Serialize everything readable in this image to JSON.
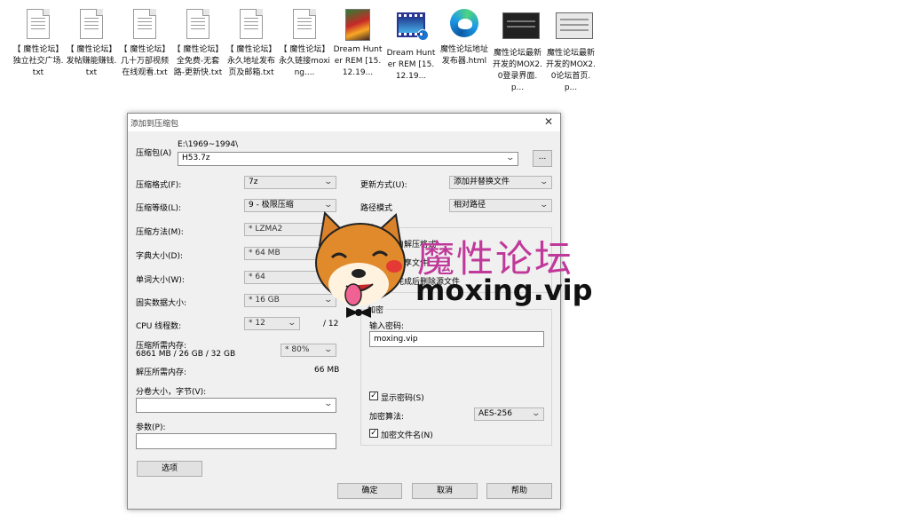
{
  "desktop": {
    "icons": [
      {
        "label": "【 魔性论坛】独立社交广场.txt",
        "type": "text-file-icon"
      },
      {
        "label": "【 魔性论坛】发帖赚能赚钱.txt",
        "type": "text-file-icon"
      },
      {
        "label": "【 魔性论坛】几十万部视频在线观看.txt",
        "type": "text-file-icon"
      },
      {
        "label": "【 魔性论坛】全免费-无套路-更新快.txt",
        "type": "text-file-icon"
      },
      {
        "label": "【 魔性论坛】永久地址发布页及邮箱.txt",
        "type": "text-file-icon"
      },
      {
        "label": "【 魔性论坛】永久链接moxing....",
        "type": "text-file-icon"
      },
      {
        "label": "Dream Hunter REM [15.12.19...",
        "type": "poster-image-icon"
      },
      {
        "label": "Dream Hunter REM [15.12.19...",
        "type": "video-file-icon"
      },
      {
        "label": "魔性论坛地址发布器.html",
        "type": "edge-browser-icon"
      },
      {
        "label": "魔性论坛最新开发的MOX2.0登录界面.p...",
        "type": "screenshot-image-icon"
      },
      {
        "label": "魔性论坛最新开发的MOX2.0论坛首页.p...",
        "type": "screenshot-image-icon"
      }
    ]
  },
  "dialog": {
    "title": "添加到压缩包",
    "close_glyph": "✕",
    "archive": {
      "label": "压缩包(A)",
      "path": "E:\\1969~1994\\",
      "filename": "H53.7z",
      "browse_label": "..."
    },
    "left": {
      "format": {
        "label": "压缩格式(F):",
        "value": "7z"
      },
      "level": {
        "label": "压缩等级(L):",
        "value": "9 - 极限压缩"
      },
      "method": {
        "label": "压缩方法(M):",
        "value": "* LZMA2"
      },
      "dict": {
        "label": "字典大小(D):",
        "value": "* 64 MB"
      },
      "word": {
        "label": "单词大小(W):",
        "value": "* 64"
      },
      "solid": {
        "label": "固实数据大小:",
        "value": "* 16 GB"
      },
      "threads": {
        "label": "CPU 线程数:",
        "value": "* 12",
        "max": "/ 12"
      },
      "mem_compress": {
        "label": "压缩所需内存:",
        "detail": "6861 MB / 26 GB / 32 GB",
        "value": "* 80%"
      },
      "mem_decompress": {
        "label": "解压所需内存:",
        "value": "66 MB"
      },
      "volume": {
        "label": "分卷大小，字节(V):",
        "value": ""
      },
      "params": {
        "label": "参数(P):",
        "value": ""
      },
      "options_button": "选项"
    },
    "right": {
      "update": {
        "label": "更新方式(U):",
        "value": "添加并替换文件"
      },
      "path_mode": {
        "label": "路径模式",
        "value": "相对路径"
      },
      "options_group": {
        "label": "选",
        "sfx": "创建自解压格式",
        "shared": "压缩共享文件",
        "delete": "压缩完成后删除源文件"
      },
      "encryption": {
        "label": "加密",
        "password_label": "输入密码:",
        "password_value": "moxing.vip",
        "show_password": "显示密码(S)",
        "method_label": "加密算法:",
        "method_value": "AES-256",
        "encrypt_names": "加密文件名(N)"
      }
    },
    "buttons": {
      "ok": "确定",
      "cancel": "取消",
      "help": "帮助"
    }
  },
  "watermark": {
    "title": "魔性论坛",
    "url": "moxing.vip",
    "colors": {
      "title": "#c0399a",
      "url": "#111111"
    }
  }
}
